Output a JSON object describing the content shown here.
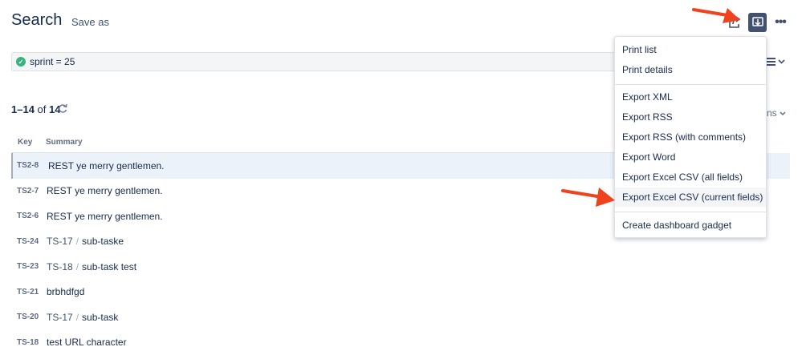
{
  "header": {
    "title": "Search",
    "save_as": "Save as"
  },
  "jql": {
    "query": "sprint = 25"
  },
  "results": {
    "range": "1–14",
    "of_label": "of",
    "total": "14"
  },
  "columns_fragment": "ns",
  "table": {
    "headers": {
      "key": "Key",
      "summary": "Summary"
    },
    "rows": [
      {
        "key": "TS2-8",
        "parent": "",
        "summary": "REST ye merry gentlemen."
      },
      {
        "key": "TS2-7",
        "parent": "",
        "summary": "REST ye merry gentlemen."
      },
      {
        "key": "TS2-6",
        "parent": "",
        "summary": "REST ye merry gentlemen."
      },
      {
        "key": "TS-24",
        "parent": "TS-17",
        "summary": "sub-taske"
      },
      {
        "key": "TS-23",
        "parent": "TS-18",
        "summary": "sub-task test"
      },
      {
        "key": "TS-21",
        "parent": "",
        "summary": "brbhdfgd"
      },
      {
        "key": "TS-20",
        "parent": "TS-17",
        "summary": "sub-task"
      },
      {
        "key": "TS-18",
        "parent": "",
        "summary": "test URL character"
      }
    ]
  },
  "export_menu": {
    "items": [
      "Print list",
      "Print details",
      "Export XML",
      "Export RSS",
      "Export RSS (with comments)",
      "Export Word",
      "Export Excel CSV (all fields)",
      "Export Excel CSV (current fields)",
      "Create dashboard gadget"
    ],
    "hovered_index": 7
  },
  "colors": {
    "accent_button": "#42526e",
    "selected_row": "#ebf2fa",
    "success": "#36b37e",
    "annotation_arrow": "#f0421c"
  },
  "icons": [
    "share-icon",
    "export-icon",
    "more-icon",
    "check-circle-icon",
    "list-view-icon",
    "refresh-icon",
    "chevron-down-icon",
    "annotation-arrow"
  ]
}
